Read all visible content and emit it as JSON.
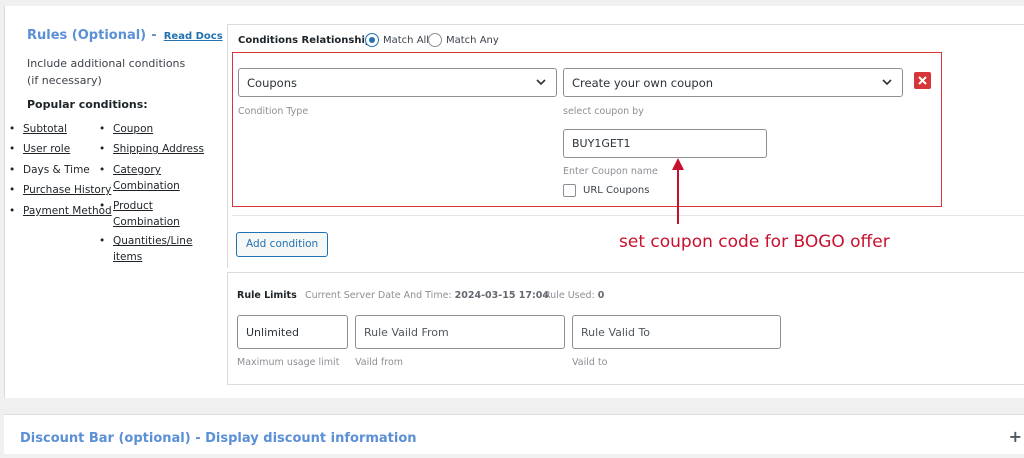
{
  "rules": {
    "title": "Rules (Optional)",
    "dash": "-",
    "read_docs": "Read Docs",
    "description": "Include additional conditions (if necessary)",
    "popular_heading": "Popular conditions:",
    "col1": [
      "Subtotal",
      "User role",
      "Days & Time",
      "Purchase History",
      "Payment Method"
    ],
    "col2": [
      "Coupon",
      "Shipping Address",
      "Category Combination",
      "Product Combination",
      "Quantities/Line items"
    ]
  },
  "conditions": {
    "relationship_label": "Conditions Relationship",
    "match_all": "Match All",
    "match_any": "Match Any",
    "selected": "Match All",
    "condition_type_value": "Coupons",
    "condition_type_hint": "Condition Type",
    "coupon_select_value": "Create your own coupon",
    "coupon_select_hint": "select coupon by",
    "coupon_name_value": "BUY1GET1",
    "coupon_name_hint": "Enter Coupon name",
    "url_coupons_label": "URL Coupons",
    "add_condition": "Add condition"
  },
  "annotation": {
    "text": "set coupon code for BOGO offer",
    "color": "#c8102e"
  },
  "limits": {
    "title": "Rule Limits",
    "server_time_label": "Current Server Date And Time:",
    "server_time_value": "2024-03-15 17:04",
    "rule_used_label": "Rule Used:",
    "rule_used_value": "0",
    "usage_value": "Unlimited",
    "usage_hint": "Maximum usage limit",
    "valid_from_placeholder": "Rule Vaild From",
    "valid_from_hint": "Vaild from",
    "valid_to_placeholder": "Rule Valid To",
    "valid_to_hint": "Vaild to"
  },
  "footer": {
    "title": "Discount Bar (optional) - Display discount information",
    "expand": "+"
  },
  "colors": {
    "accent": "#2271b1",
    "heading_blue": "#5b8fd6",
    "danger": "#d63638"
  }
}
